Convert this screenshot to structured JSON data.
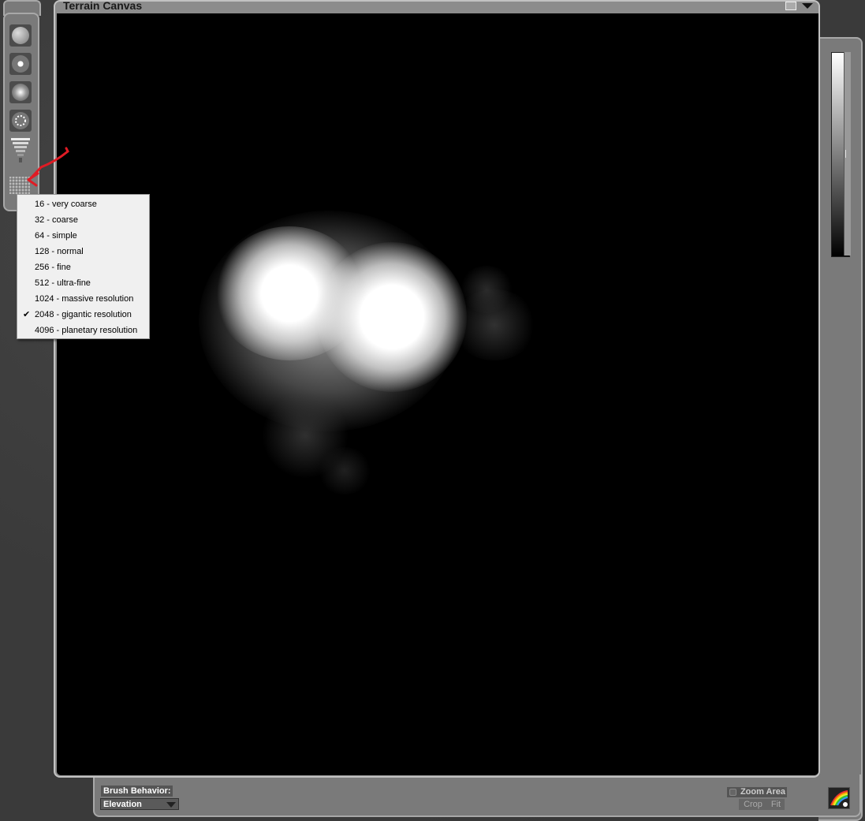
{
  "window": {
    "title": "Terrain Canvas"
  },
  "resolution_menu": {
    "items": [
      {
        "label": "16 - very coarse",
        "checked": false
      },
      {
        "label": "32 - coarse",
        "checked": false
      },
      {
        "label": "64 - simple",
        "checked": false
      },
      {
        "label": "128 - normal",
        "checked": false
      },
      {
        "label": "256 - fine",
        "checked": false
      },
      {
        "label": "512 - ultra-fine",
        "checked": false
      },
      {
        "label": "1024 - massive resolution",
        "checked": false
      },
      {
        "label": "2048 - gigantic resolution",
        "checked": true
      },
      {
        "label": "4096 - planetary resolution",
        "checked": false
      }
    ],
    "check_glyph": "✔"
  },
  "bottom_bar": {
    "brush_behavior_label": "Brush Behavior:",
    "brush_behavior_value": "Elevation",
    "zoom_area_label": "Zoom Area",
    "crop_label": "Crop",
    "fit_label": "Fit"
  },
  "tools": [
    {
      "icon": "sphere-brush-icon"
    },
    {
      "icon": "dot-brush-icon"
    },
    {
      "icon": "soft-brush-icon"
    },
    {
      "icon": "spray-brush-icon"
    },
    {
      "icon": "strength-bars-icon"
    },
    {
      "icon": "grid-resolution-icon"
    }
  ],
  "colors": {
    "annotation_arrow": "#e01b24",
    "canvas_bg": "#000000",
    "panel_bg": "#7a7a7a"
  }
}
